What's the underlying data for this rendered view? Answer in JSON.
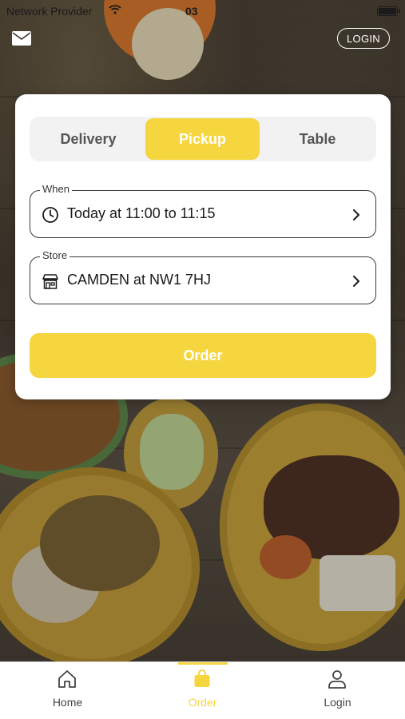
{
  "status_bar": {
    "carrier": "Network Provider",
    "time": "03",
    "wifi_icon": "wifi-icon",
    "battery_icon": "battery-icon"
  },
  "header": {
    "mail_icon": "mail-icon",
    "login_label": "LOGIN"
  },
  "order_card": {
    "tabs": [
      {
        "label": "Delivery",
        "selected": false
      },
      {
        "label": "Pickup",
        "selected": true
      },
      {
        "label": "Table",
        "selected": false
      }
    ],
    "when_field": {
      "legend": "When",
      "value": "Today at 11:00 to 11:15",
      "icon": "clock-icon"
    },
    "store_field": {
      "legend": "Store",
      "value": "CAMDEN at NW1 7HJ",
      "icon": "store-icon"
    },
    "order_button_label": "Order"
  },
  "tab_bar": {
    "items": [
      {
        "label": "Home",
        "icon": "home-icon",
        "active": false
      },
      {
        "label": "Order",
        "icon": "shopping-bag-icon",
        "active": true
      },
      {
        "label": "Login",
        "icon": "user-icon",
        "active": false
      }
    ]
  },
  "colors": {
    "accent": "#f5d63f",
    "card": "#ffffff",
    "text": "#1a1a1a"
  }
}
